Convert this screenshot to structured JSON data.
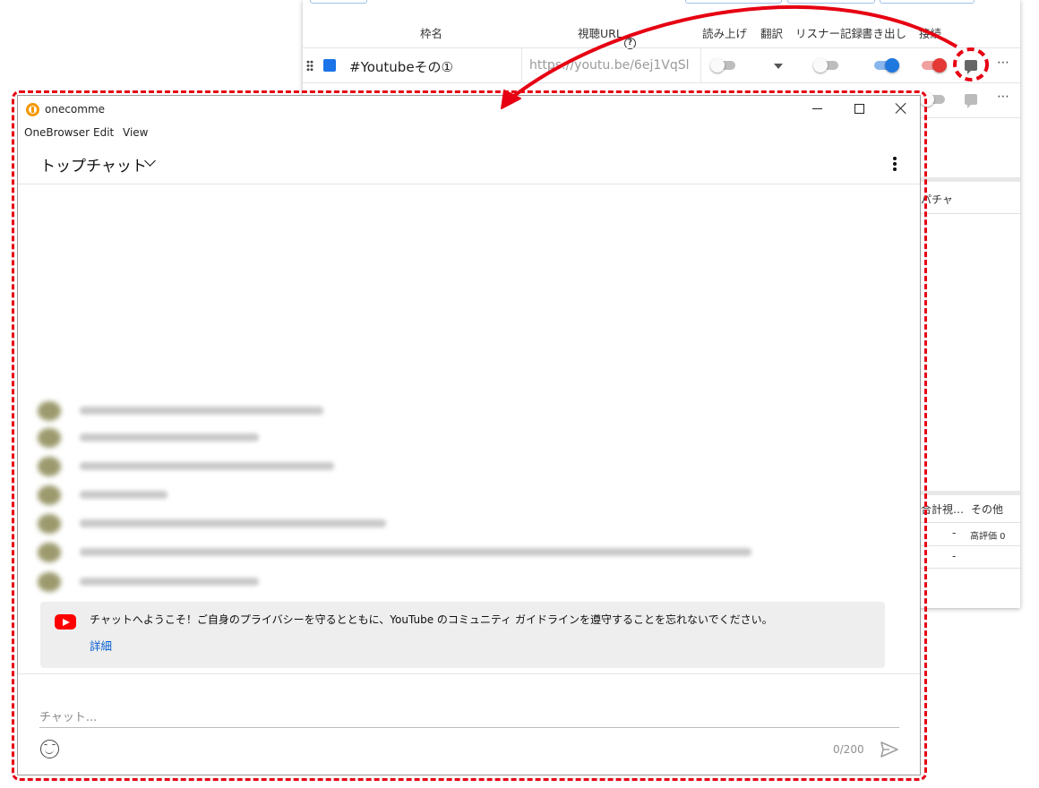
{
  "bg_app": {
    "headers": {
      "frame_name": "枠名",
      "url": "視聴URL",
      "url_help": "?",
      "read_aloud": "読み上げ",
      "translate": "翻訳",
      "listener_log": "リスナー記録",
      "export": "書き出し",
      "connect": "接続"
    },
    "rows": [
      {
        "name": "#Youtubeその①",
        "url": "https://youtu.be/6ej1VqSl",
        "color": "#1a73e8"
      }
    ],
    "lower": {
      "col_fragment": "パチャ",
      "stats_header": "合計視…",
      "other_header": "その他",
      "dash": "-",
      "likes": "高評価 0"
    }
  },
  "chat_window": {
    "app_title": "onecomme",
    "menu": [
      "OneBrowser",
      "Edit",
      "View"
    ],
    "chat_mode": "トップチャット",
    "welcome_text": "チャットへようこそ！ご自身のプライバシーを守るとともに、YouTube のコミュニティ ガイドラインを遵守することを忘れないでください。",
    "welcome_link": "詳細",
    "input_placeholder": "チャット...",
    "char_count": "0/200"
  },
  "icons": {
    "logo": "onecomme-logo-icon",
    "youtube": "youtube-logo-icon",
    "emoji": "emoji-icon",
    "send": "send-icon",
    "comment": "comment-icon"
  },
  "colors": {
    "annotation": "#e60012",
    "link": "#065fd4",
    "youtube_red": "#ff0000",
    "toggle_blue": "#1f78de",
    "toggle_red": "#e53935"
  }
}
